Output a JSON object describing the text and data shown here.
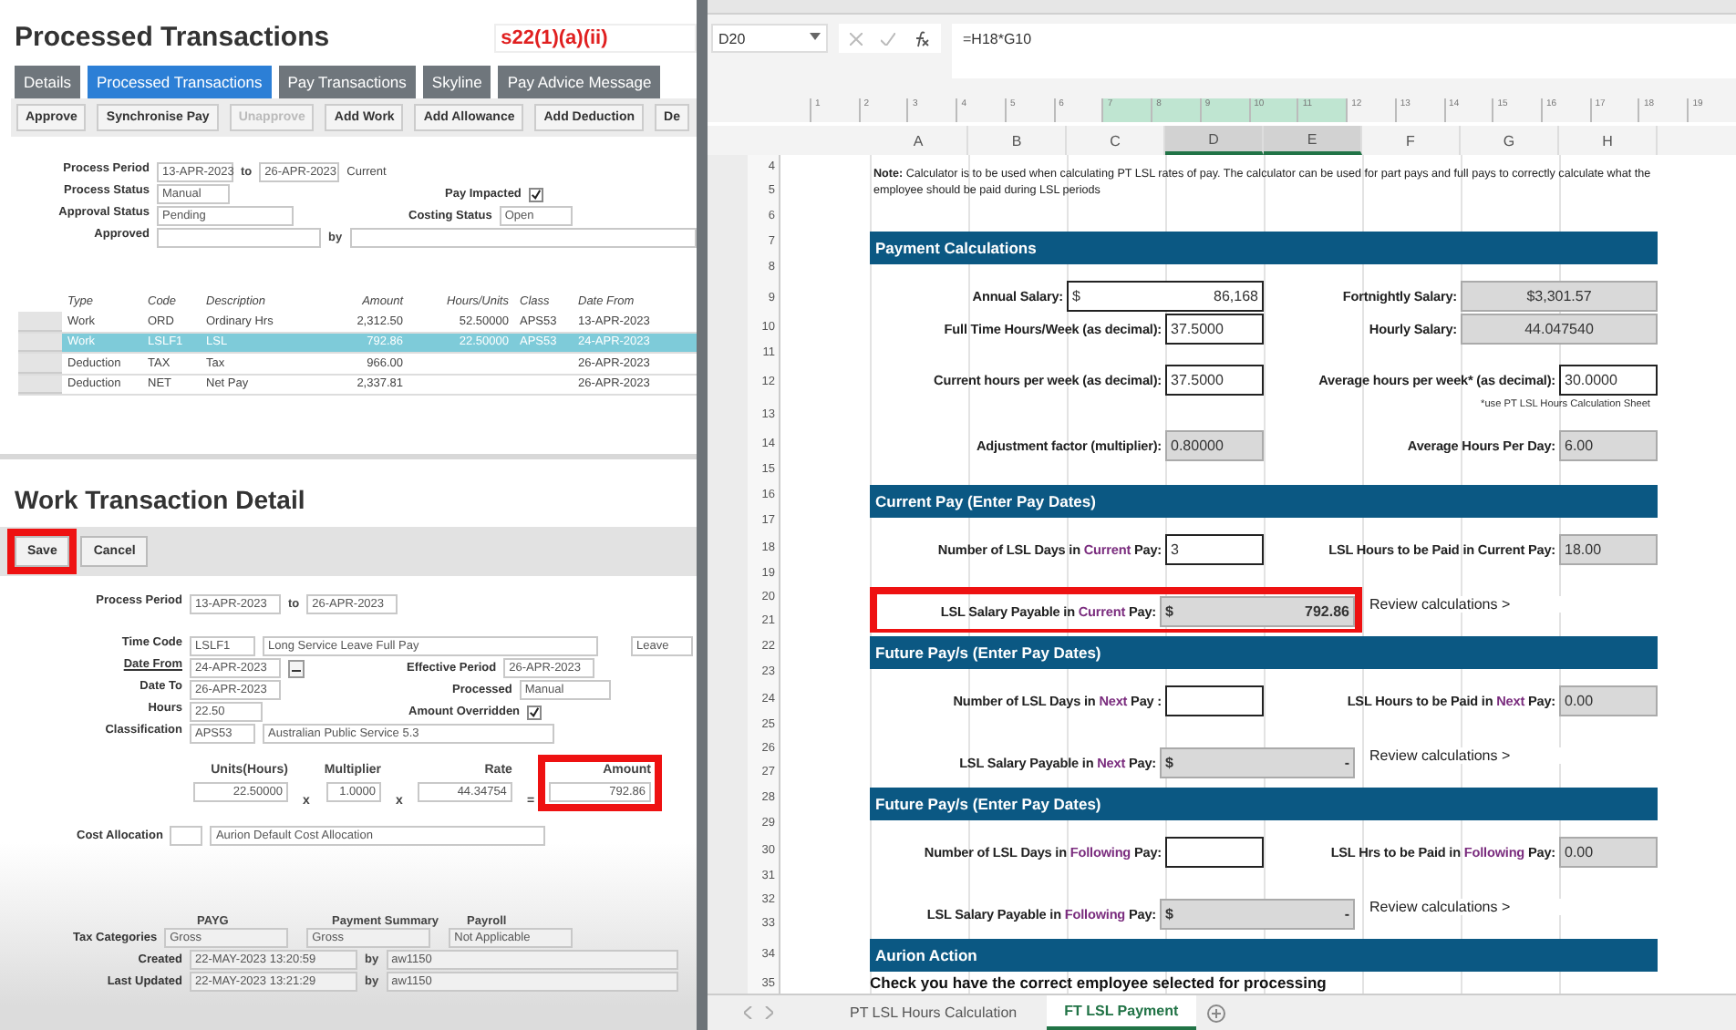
{
  "transactions": {
    "title": "Processed Transactions",
    "reference": "s22(1)(a)(ii)",
    "tabs": [
      {
        "label": "Details",
        "selected": false
      },
      {
        "label": "Processed Transactions",
        "selected": true
      },
      {
        "label": "Pay Transactions",
        "selected": false
      },
      {
        "label": "Skyline",
        "selected": false
      },
      {
        "label": "Pay Advice Message",
        "selected": false
      }
    ],
    "actions": [
      {
        "label": "Approve",
        "disabled": false
      },
      {
        "label": "Synchronise Pay",
        "disabled": false
      },
      {
        "label": "Unapprove",
        "disabled": true
      },
      {
        "label": "Add Work",
        "disabled": false
      },
      {
        "label": "Add Allowance",
        "disabled": false
      },
      {
        "label": "Add Deduction",
        "disabled": false
      },
      {
        "label": "De",
        "disabled": false
      }
    ],
    "process_period": {
      "label": "Process Period",
      "from": "13-APR-2023",
      "to_label": "to",
      "to": "26-APR-2023",
      "note": "Current"
    },
    "process_status": {
      "label": "Process Status",
      "value": "Manual"
    },
    "pay_impacted": {
      "label": "Pay Impacted",
      "checked": true
    },
    "approval_status": {
      "label": "Approval Status",
      "value": "Pending"
    },
    "costing_status": {
      "label": "Costing Status",
      "value": "Open"
    },
    "approved": {
      "label": "Approved",
      "by_label": "by"
    },
    "table": {
      "columns": [
        "Type",
        "Code",
        "Description",
        "Amount",
        "Hours/Units",
        "Class",
        "Date From"
      ],
      "rows": [
        {
          "cells": [
            "Work",
            "ORD",
            "Ordinary Hrs",
            "2,312.50",
            "52.50000",
            "APS53",
            "13-APR-2023"
          ],
          "selected": false
        },
        {
          "cells": [
            "Work",
            "LSLF1",
            "LSL",
            "792.86",
            "22.50000",
            "APS53",
            "24-APR-2023"
          ],
          "selected": true
        },
        {
          "cells": [
            "Deduction",
            "TAX",
            "Tax",
            "966.00",
            "",
            "",
            "26-APR-2023"
          ],
          "selected": false
        },
        {
          "cells": [
            "Deduction",
            "NET",
            "Net Pay",
            "2,337.81",
            "",
            "",
            "26-APR-2023"
          ],
          "selected": false
        }
      ]
    }
  },
  "detail": {
    "title": "Work Transaction Detail",
    "buttons": [
      {
        "label": "Save",
        "highlighted": true
      },
      {
        "label": "Cancel",
        "highlighted": false
      }
    ],
    "process_period": {
      "label": "Process Period",
      "from": "13-APR-2023",
      "to_label": "to",
      "to": "26-APR-2023"
    },
    "time_code": {
      "label": "Time Code",
      "code": "LSLF1",
      "description": "Long Service Leave Full Pay",
      "category": "Leave"
    },
    "date_from": {
      "label": "Date From",
      "value": "24-APR-2023"
    },
    "effective_period": {
      "label": "Effective Period",
      "value": "26-APR-2023"
    },
    "date_to": {
      "label": "Date To",
      "value": "26-APR-2023"
    },
    "processed": {
      "label": "Processed",
      "value": "Manual"
    },
    "hours": {
      "label": "Hours",
      "value": "22.50"
    },
    "amount_overridden": {
      "label": "Amount Overridden",
      "checked": true
    },
    "classification": {
      "label": "Classification",
      "code": "APS53",
      "description": "Australian Public Service 5.3"
    },
    "calculation": [
      {
        "label": "Units(Hours)",
        "value": "22.50000",
        "operator": "x",
        "highlighted": false
      },
      {
        "label": "Multiplier",
        "value": "1.0000",
        "operator": "x",
        "highlighted": false
      },
      {
        "label": "Rate",
        "value": "44.34754",
        "operator": "=",
        "highlighted": false
      },
      {
        "label": "Amount",
        "value": "792.86",
        "highlighted": true
      }
    ],
    "cost_allocation": {
      "label": "Cost Allocation",
      "description": "Aurion Default Cost Allocation"
    },
    "tax_categories": {
      "label": "Tax Categories",
      "columns": [
        "PAYG",
        "Payment Summary",
        "Payroll"
      ],
      "values": [
        "Gross",
        "Gross",
        "Not Applicable"
      ]
    },
    "audit": [
      {
        "label": "Created",
        "value": "22-MAY-2023 13:20:59",
        "by_label": "by",
        "by": "aw1150"
      },
      {
        "label": "Last Updated",
        "value": "22-MAY-2023 13:21:29",
        "by_label": "by",
        "by": "aw1150"
      }
    ]
  },
  "spreadsheet": {
    "name_box": "D20",
    "formula": "=H18*G10",
    "ruler": [
      {
        "label": "1",
        "selected": false
      },
      {
        "label": "2",
        "selected": false
      },
      {
        "label": "3",
        "selected": false
      },
      {
        "label": "4",
        "selected": false
      },
      {
        "label": "5",
        "selected": false
      },
      {
        "label": "6",
        "selected": false
      },
      {
        "label": "7",
        "selected": true
      },
      {
        "label": "8",
        "selected": true
      },
      {
        "label": "9",
        "selected": true
      },
      {
        "label": "10",
        "selected": true
      },
      {
        "label": "11",
        "selected": true
      },
      {
        "label": "12",
        "selected": false
      },
      {
        "label": "13",
        "selected": false
      },
      {
        "label": "14",
        "selected": false
      },
      {
        "label": "15",
        "selected": false
      },
      {
        "label": "16",
        "selected": false
      },
      {
        "label": "17",
        "selected": false
      },
      {
        "label": "18",
        "selected": false
      },
      {
        "label": "19",
        "selected": false
      }
    ],
    "columns": [
      {
        "label": "A",
        "selected": false
      },
      {
        "label": "B",
        "selected": false
      },
      {
        "label": "C",
        "selected": false
      },
      {
        "label": "D",
        "selected": true
      },
      {
        "label": "E",
        "selected": true
      },
      {
        "label": "F",
        "selected": false
      },
      {
        "label": "G",
        "selected": false
      },
      {
        "label": "H",
        "selected": false
      }
    ],
    "blocks": [
      {
        "kind": "note",
        "rows": [
          "4",
          "5",
          "6"
        ],
        "text": "**Note:** Calculator is to be used when calculating PT LSL rates of pay. The calculator can be used for part pays and full pays to correctly calculate what the employee should be paid during LSL periods"
      },
      {
        "kind": "header",
        "rows": [
          "7",
          "8"
        ],
        "text": "Payment Calculations"
      },
      {
        "kind": "fields",
        "rows": [
          "9"
        ],
        "left": {
          "label": [
            "Annual Salary:"
          ],
          "value": {
            "kind": "money",
            "symbol": "$",
            "text": "86,168"
          }
        },
        "right": {
          "label": [
            "Fortnightly Salary:"
          ],
          "value": {
            "kind": "wide",
            "text": "$3,301.57"
          }
        }
      },
      {
        "kind": "fields",
        "rows": [
          "10",
          "11"
        ],
        "left": {
          "label": [
            "Full Time Hours/Week (as decimal):"
          ],
          "value": {
            "kind": "input",
            "text": "37.5000"
          }
        },
        "right": {
          "label": [
            "Hourly Salary:"
          ],
          "value": {
            "kind": "wide",
            "text": "44.047540"
          }
        }
      },
      {
        "kind": "fields",
        "rows": [
          "12",
          "13"
        ],
        "left": {
          "label": [
            "Current hours per week (as decimal):"
          ],
          "value": {
            "kind": "input",
            "text": "37.5000"
          }
        },
        "right": {
          "label": [
            "Average hours per week* (as decimal):"
          ],
          "value": {
            "kind": "input",
            "text": "30.0000"
          }
        },
        "footnote": "*use PT LSL Hours Calculation Sheet"
      },
      {
        "kind": "fields",
        "rows": [
          "14",
          "15"
        ],
        "left": {
          "label": [
            "Adjustment factor (multiplier):"
          ],
          "value": {
            "kind": "calc",
            "text": "0.80000"
          }
        },
        "right": {
          "label": [
            "Average Hours Per Day:"
          ],
          "value": {
            "kind": "calc",
            "text": "6.00"
          }
        }
      },
      {
        "kind": "header",
        "rows": [
          "16",
          "17"
        ],
        "text": "Current Pay (Enter Pay Dates)"
      },
      {
        "kind": "fields",
        "rows": [
          "18",
          "19"
        ],
        "left": {
          "label": [
            "Number of LSL Days in ",
            "Current",
            " Pay:"
          ],
          "value": {
            "kind": "input",
            "text": "3"
          }
        },
        "right": {
          "label": [
            "LSL Hours to be Paid in Current Pay:"
          ],
          "value": {
            "kind": "calc",
            "text": "18.00"
          }
        }
      },
      {
        "kind": "payable",
        "rows": [
          "20",
          "21"
        ],
        "label": [
          "LSL Salary Payable in ",
          "Current",
          " Pay:"
        ],
        "symbol": "$",
        "value": "792.86",
        "link": "Review calculations >",
        "highlighted": true
      },
      {
        "kind": "header",
        "rows": [
          "22",
          "23"
        ],
        "text": "Future Pay/s (Enter Pay Dates)"
      },
      {
        "kind": "fields",
        "rows": [
          "24",
          "25"
        ],
        "left": {
          "label": [
            "Number of LSL Days in ",
            "Next",
            " Pay :"
          ],
          "value": {
            "kind": "input"
          }
        },
        "right": {
          "label": [
            "LSL Hours to be Paid in ",
            "Next",
            " Pay:"
          ],
          "value": {
            "kind": "calc",
            "text": "0.00"
          }
        }
      },
      {
        "kind": "payable",
        "rows": [
          "26",
          "27"
        ],
        "label": [
          "LSL Salary Payable in ",
          "Next",
          " Pay:"
        ],
        "symbol": "$",
        "value": "-",
        "link": "Review calculations >",
        "highlighted": false
      },
      {
        "kind": "header",
        "rows": [
          "28",
          "29"
        ],
        "text": "Future Pay/s (Enter Pay Dates)"
      },
      {
        "kind": "fields",
        "rows": [
          "30",
          "31"
        ],
        "left": {
          "label": [
            "Number of LSL Days in ",
            "Following",
            " Pay:"
          ],
          "value": {
            "kind": "input"
          }
        },
        "right": {
          "label": [
            "LSL Hrs to be Paid in ",
            "Following",
            " Pay:"
          ],
          "value": {
            "kind": "calc",
            "text": "0.00"
          }
        }
      },
      {
        "kind": "payable",
        "rows": [
          "32",
          "33"
        ],
        "label": [
          "LSL Salary Payable in ",
          "Following",
          " Pay:"
        ],
        "symbol": "$",
        "value": "-",
        "link": "Review calculations >",
        "highlighted": false
      },
      {
        "kind": "header",
        "rows": [
          "34"
        ],
        "text": "Aurion Action"
      },
      {
        "kind": "text",
        "rows": [
          "35"
        ],
        "text": "Check you have the correct employee selected for processing"
      }
    ],
    "sheets": [
      {
        "label": "PT LSL Hours Calculation",
        "selected": false
      },
      {
        "label": "FT LSL Payment",
        "selected": true
      }
    ]
  }
}
